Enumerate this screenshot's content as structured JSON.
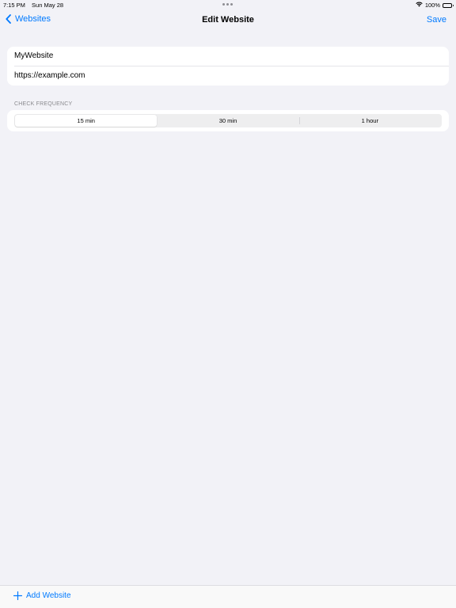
{
  "status_bar": {
    "time": "7:15 PM",
    "date": "Sun May 28",
    "battery": "100%",
    "battery_level": 1.0,
    "icons": [
      "multitasking-dots-icon",
      "wifi-icon",
      "battery-icon"
    ]
  },
  "nav": {
    "back_label": "Websites",
    "title": "Edit Website",
    "save_label": "Save",
    "back_icon": "chevron-left-icon"
  },
  "form": {
    "name_value": "MyWebsite",
    "url_value": "https://example.com"
  },
  "frequency": {
    "section_label": "CHECK FREQUENCY",
    "options": [
      "15 min",
      "30 min",
      "1 hour"
    ],
    "selected": "15 min"
  },
  "toolbar": {
    "add_label": "Add Website",
    "add_icon": "plus-icon"
  },
  "colors": {
    "accent": "#007aff",
    "background": "#f2f2f7",
    "card": "#ffffff",
    "secondary_text": "#8a8a8e"
  }
}
